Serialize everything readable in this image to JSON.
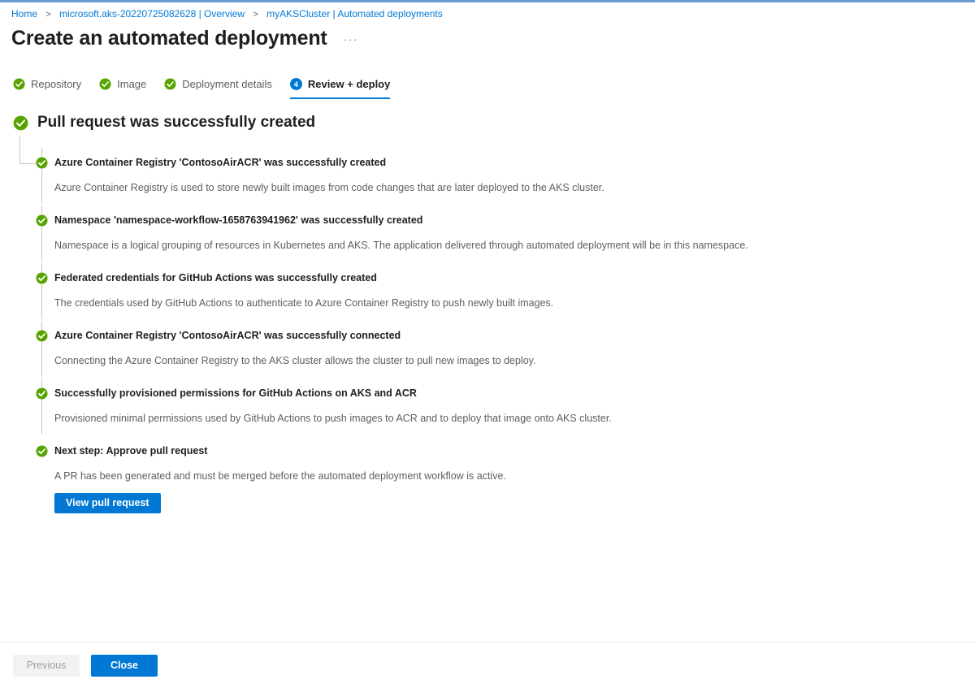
{
  "colors": {
    "accent": "#0078d4",
    "success": "#57a300",
    "link": "#0078d4",
    "muted": "#605e5c",
    "top_accent": "#6b9bd2"
  },
  "breadcrumb": {
    "separator": ">",
    "items": [
      {
        "label": "Home"
      },
      {
        "label": "microsoft.aks-20220725082628 | Overview"
      },
      {
        "label": "myAKSCluster | Automated deployments"
      }
    ]
  },
  "header": {
    "title": "Create an automated deployment",
    "ellipsis": "···"
  },
  "tabs": [
    {
      "label": "Repository",
      "state": "complete",
      "icon": "check-circle-icon"
    },
    {
      "label": "Image",
      "state": "complete",
      "icon": "check-circle-icon"
    },
    {
      "label": "Deployment details",
      "state": "complete",
      "icon": "check-circle-icon"
    },
    {
      "label": "Review + deploy",
      "state": "active",
      "number": "4",
      "icon": "step-number-badge"
    }
  ],
  "result": {
    "heading": "Pull request was successfully created",
    "icon": "check-circle-icon"
  },
  "steps": [
    {
      "title": "Azure Container Registry 'ContosoAirACR' was successfully created",
      "description": "Azure Container Registry is used to store newly built images from code changes that are later deployed to the AKS cluster."
    },
    {
      "title": "Namespace 'namespace-workflow-1658763941962' was successfully created",
      "description": "Namespace is a logical grouping of resources in Kubernetes and AKS. The application delivered through automated deployment will be in this namespace."
    },
    {
      "title": "Federated credentials for GitHub Actions was successfully created",
      "description": "The credentials used by GitHub Actions to authenticate to Azure Container Registry to push newly built images."
    },
    {
      "title": "Azure Container Registry 'ContosoAirACR' was successfully connected",
      "description": "Connecting the Azure Container Registry to the AKS cluster allows the cluster to pull new images to deploy."
    },
    {
      "title": "Successfully provisioned permissions for GitHub Actions on AKS and ACR",
      "description": "Provisioned minimal permissions used by GitHub Actions to push images to ACR and to deploy that image onto AKS cluster."
    },
    {
      "title": "Next step: Approve pull request",
      "description": "A PR has been generated and must be merged before the automated deployment workflow is active.",
      "action_label": "View pull request"
    }
  ],
  "footer": {
    "previous_label": "Previous",
    "previous_disabled": true,
    "close_label": "Close"
  }
}
